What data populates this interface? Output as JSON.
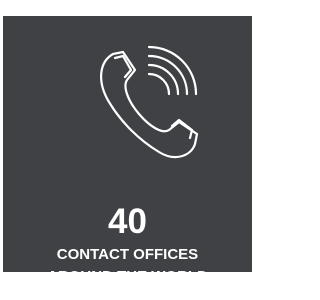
{
  "stat": {
    "count": "40",
    "caption_line1": "CONTACT OFFICES",
    "caption_line2": "AROUND THE WORLD",
    "icon": "phone-call-icon",
    "background_color": "#3f4144",
    "foreground_color": "#ffffff"
  }
}
